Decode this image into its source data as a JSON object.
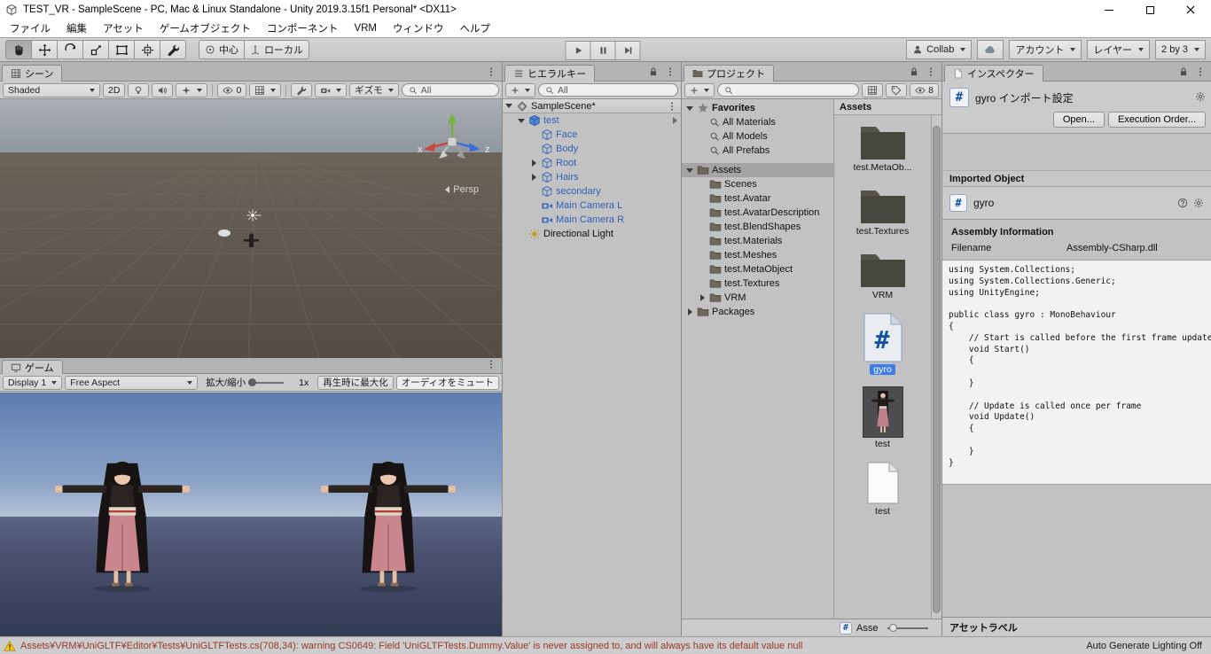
{
  "window": {
    "title": "TEST_VR - SampleScene - PC, Mac & Linux Standalone - Unity 2019.3.15f1 Personal* <DX11>"
  },
  "menu": {
    "items": [
      "ファイル",
      "編集",
      "アセット",
      "ゲームオブジェクト",
      "コンポーネント",
      "VRM",
      "ウィンドウ",
      "ヘルプ"
    ]
  },
  "toolbar": {
    "pivot": "中心",
    "orientation": "ローカル",
    "collab": "Collab",
    "account": "アカウント",
    "layers": "レイヤー",
    "layout": "2 by 3"
  },
  "scene": {
    "tab": "シーン",
    "draw_mode": "Shaded",
    "toggle_2d": "2D",
    "visibility_count": "0",
    "gizmos": "ギズモ",
    "search_text": "All",
    "axis_x": "x",
    "axis_z": "z",
    "projection": "Persp"
  },
  "game": {
    "tab": "ゲーム",
    "display": "Display 1",
    "aspect": "Free Aspect",
    "scale_label": "拡大/縮小",
    "scale_value": "1x",
    "maximize_on_play": "再生時に最大化",
    "mute_audio": "オーディオをミュート"
  },
  "hierarchy": {
    "tab": "ヒエラルキー",
    "search_text": "All",
    "scene_row": {
      "label": "SampleScene*"
    },
    "items": [
      {
        "label": "test"
      },
      {
        "label": "Face"
      },
      {
        "label": "Body"
      },
      {
        "label": "Root"
      },
      {
        "label": "Hairs"
      },
      {
        "label": "secondary"
      },
      {
        "label": "Main Camera L"
      },
      {
        "label": "Main Camera R"
      },
      {
        "label": "Directional Light"
      }
    ]
  },
  "project": {
    "tab": "プロジェクト",
    "favorites": {
      "label": "Favorites",
      "items": [
        {
          "label": "All Materials"
        },
        {
          "label": "All Models"
        },
        {
          "label": "All Prefabs"
        }
      ]
    },
    "assets_root": "Assets",
    "assets_children": [
      {
        "label": "Scenes"
      },
      {
        "label": "test.Avatar"
      },
      {
        "label": "test.AvatarDescription"
      },
      {
        "label": "test.BlendShapes"
      },
      {
        "label": "test.Materials"
      },
      {
        "label": "test.Meshes"
      },
      {
        "label": "test.MetaObject"
      },
      {
        "label": "test.Textures"
      },
      {
        "label": "VRM"
      }
    ],
    "packages_root": "Packages",
    "pane_header": "Assets",
    "hidden_count": "8",
    "grid": [
      {
        "label": "test.MetaOb...",
        "type": "folder"
      },
      {
        "label": "test.Textures",
        "type": "folder"
      },
      {
        "label": "VRM",
        "type": "folder"
      },
      {
        "label": "gyro",
        "type": "script"
      },
      {
        "label": "test",
        "type": "model"
      },
      {
        "label": "test",
        "type": "document"
      }
    ],
    "footer_text": "Asse"
  },
  "inspector": {
    "tab": "インスペクター",
    "title": "gyro インポート設定",
    "open_button": "Open...",
    "execution_order_button": "Execution Order...",
    "imported_object": "Imported Object",
    "object_name": "gyro",
    "assembly_information": "Assembly Information",
    "filename_label": "Filename",
    "filename_value": "Assembly-CSharp.dll",
    "code": "using System.Collections;\nusing System.Collections.Generic;\nusing UnityEngine;\n\npublic class gyro : MonoBehaviour\n{\n    // Start is called before the first frame update\n    void Start()\n    {\n        \n    }\n\n    // Update is called once per frame\n    void Update()\n    {\n        \n    }\n}",
    "asset_labels": "アセットラベル"
  },
  "statusbar": {
    "message": "Assets¥VRM¥UniGLTF¥Editor¥Tests¥UniGLTFTests.cs(708,34): warning CS0649: Field 'UniGLTFTests.Dummy.Value' is never assigned to, and will always have its default value null",
    "lighting": "Auto Generate Lighting Off"
  }
}
